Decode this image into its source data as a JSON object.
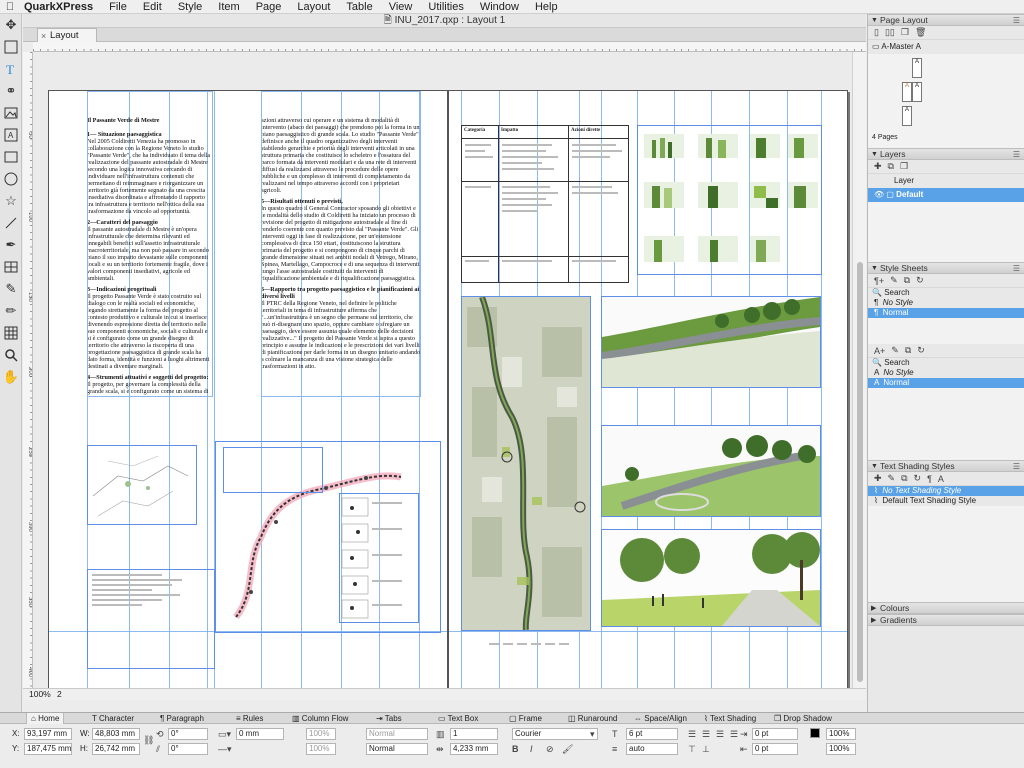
{
  "menubar": {
    "app": "QuarkXPress",
    "items": [
      "File",
      "Edit",
      "Style",
      "Item",
      "Page",
      "Layout",
      "Table",
      "View",
      "Utilities",
      "Window",
      "Help"
    ]
  },
  "window": {
    "title": "INU_2017.qxp : Layout 1",
    "tab": "Layout 1"
  },
  "ruler_left_labels": [
    "50",
    "100",
    "150",
    "200",
    "250",
    "300",
    "350",
    "400"
  ],
  "document": {
    "left_page": {
      "heading": "Il Passante Verde di Mestre",
      "col1": [
        {
          "h": "1— Situazione paesaggistica",
          "t": "Nel 2005 Coldiretti Venezia ha promosso in collaborazione con la Regione Veneto lo studio \"Passante Verde\", che ha individuato il tema della realizzazione del passante autostradale di Mestre secondo una logica innovativa cercando di individuare nell'infrastruttura contenuti che permettano di reimmaginare e riorganizzare un territorio già fortemente segnato da una crescita insediativa disordinata e affrontando il rapporto tra infrastruttura e territorio nell'ottica della sua trasformazione da vincolo ad opportunità."
        },
        {
          "h": "2—Caratteri del paesaggio",
          "t": "Il passante autostradale di Mestre è un'opera infrastrutturale che determina rilevanti ed innegabili benefici sull'assetto infrastrutturale macroterritoriale, ma non può passare in secondo piano il suo impatto devastante sulle componenti locali e su un territorio fortemente fragile, dove i valori componenti insediativi, agricole ed ambientali."
        },
        {
          "h": "3—Indicazioni progettuali",
          "t": "Il progetto Passante Verde è stato costruito sul dialogo con le realtà sociali ed economiche, legando strettamente la forma del progetto al contesto produttivo e culturale in cui si inserisce divenendo espressione diretta del territorio nelle sue componenti economiche, sociali e culturali e si è configurato come un grande disegno di territorio che attraverso la riscoperta di una progettazione paesaggistica di grande scala ha dato forma, identità e funzioni a luoghi altrimenti destinati a diventare marginali."
        },
        {
          "h": "4—Strumenti attuativi e soggetti del progetto:",
          "t": "Il progetto, per governare la complessità della grande scala, si è configurato come un sistema di regole e principi difendibile con modalità operative che possano essere replicate in contesti diversi, l'approccio metodologico e partire dall'individuazione delle strategie di un sistema di regole e di"
        }
      ],
      "col2": [
        {
          "h": "",
          "t": "azioni attraverso cui operare e un sistema di modalità di intervento (abaco dei paesaggi) che prendono poi la forma in un piano paesaggistico di grande scala. Lo studio \"Passante Verde\" definisce anche il quadro organizzativo degli interventi stabilendo gerarchie e priorità degli interventi articolati in una struttura primaria che costituisce lo scheletro e l'ossatura del parco formata da interventi modulari e da una rete di interventi diffusi da realizzarsi attraverso le procedure delle opere pubbliche e un complesso di interventi di completamento da realizzarsi nel tempo attraverso accordi con i proprietari agricoli."
        },
        {
          "h": "5—Risultati ottenuti o previsti,",
          "t": "In questo quadro il General Contractor sposando gli obiettivi e le modalità dello studio di Coldiretti ha iniziato un processo di revisione del progetto di mitigazione autostradale al fine di renderlo coerente con quanto previsto dal \"Passante Verde\". Gli interventi oggi in fase di realizzazione, per un'estensione complessiva di circa 150 ettari, costituiscono la struttura primaria del progetto e si compongono di cinque parchi di grande dimensione situati nei ambiti nodali di Vetrego, Mirano, Spinea, Martellago, Campocroce e di una sequenza di interventi lungo l'asse autostradale costituiti da interventi di riqualificazione ambientale e di riqualificazione paesaggistica."
        },
        {
          "h": "6—Rapporto tra progetto paesaggistico e le pianificazioni ai diversi livelli",
          "t": "Il PTRC della Regione Veneto, nel definire le politiche territoriali in tema di infrastrutture afferma che \"...un'infrastruttura è un segno che permane sul territorio, che può ri-disegnare uno spazio, oppure cambiare o sfregiare un paesaggio, deve essere assunta quale elemento delle decisioni realizzative...\" Il progetto del Passante Verde si ispira a questo principio e assume le indicazioni e le prescrizioni dei vari livelli di pianificazione per darle forma in un disegno unitario andando a colmare la mancanza di una visione strategica delle trasformazioni in atto."
        }
      ]
    },
    "right_page": {
      "table_headers": [
        "Categoria",
        "Impatto",
        "Azioni dirette"
      ]
    }
  },
  "statusbar": {
    "zoom": "100%",
    "page": "2"
  },
  "palettes": {
    "page_layout": {
      "title": "Page Layout",
      "master": "A-Master A",
      "count": "4 Pages",
      "page_letters": [
        "A",
        "A",
        "A",
        "A"
      ]
    },
    "layers": {
      "title": "Layers",
      "rows": [
        "Layer",
        "Default"
      ]
    },
    "style_sheets": {
      "title": "Style Sheets",
      "search": "Search",
      "para": [
        "No Style",
        "Normal"
      ],
      "char": [
        "No Style",
        "Normal"
      ]
    },
    "text_shading": {
      "title": "Text Shading Styles",
      "rows": [
        "No Text Shading Style",
        "Default Text Shading Style"
      ]
    },
    "bottom": [
      "Colours",
      "Gradients"
    ]
  },
  "measure": {
    "tabs": [
      "Home",
      "Character",
      "Paragraph",
      "Rules",
      "Column Flow",
      "Tabs",
      "Text Box",
      "Frame",
      "Runaround",
      "Space/Align",
      "Text Shading",
      "Drop Shadow"
    ],
    "x_label": "X:",
    "x": "93,197 mm",
    "y_label": "Y:",
    "y": "187,475 mm",
    "w_label": "W:",
    "w": "48,803 mm",
    "h_label": "H:",
    "h": "26,742 mm",
    "angle1": "0°",
    "angle2": "0°",
    "stroke": "0 mm",
    "opacity1": "100%",
    "opacity2": "100%",
    "blend1": "Normal",
    "blend2": "Normal",
    "cols": "1",
    "gutter": "4,233 mm",
    "font": "Courier",
    "size": "6 pt",
    "leading": "auto",
    "indent1": "0 pt",
    "indent2": "0 pt",
    "scale1": "100%",
    "scale2": "100%"
  }
}
